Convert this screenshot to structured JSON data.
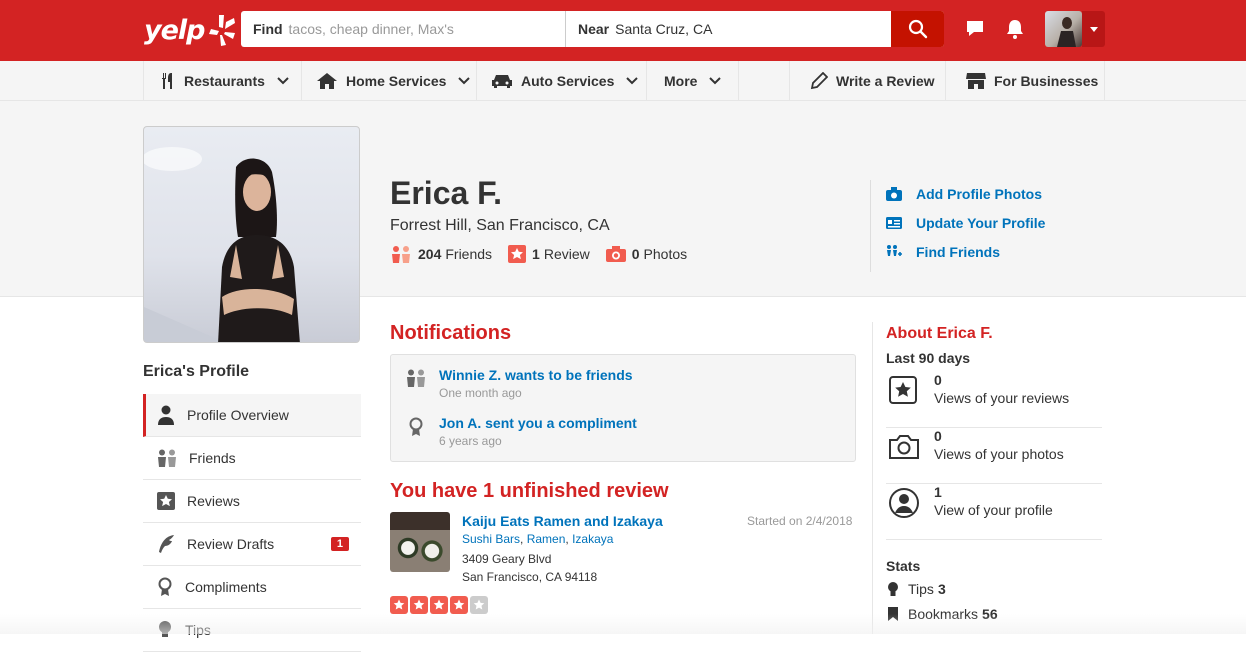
{
  "header": {
    "logo": "yelp",
    "search_find_label": "Find",
    "search_find_placeholder": "tacos, cheap dinner, Max's",
    "search_near_label": "Near",
    "search_near_value": "Santa Cruz, CA"
  },
  "nav": {
    "items": [
      {
        "label": "Restaurants"
      },
      {
        "label": "Home Services"
      },
      {
        "label": "Auto Services"
      },
      {
        "label": "More"
      }
    ],
    "write_review": "Write a Review",
    "for_businesses": "For Businesses"
  },
  "profile": {
    "name": "Erica F.",
    "location": "Forrest Hill, San Francisco, CA",
    "friends_count": "204",
    "friends_label": "Friends",
    "reviews_count": "1",
    "reviews_label": "Review",
    "photos_count": "0",
    "photos_label": "Photos"
  },
  "actions": {
    "add_photos": "Add Profile Photos",
    "update_profile": "Update Your Profile",
    "find_friends": "Find Friends"
  },
  "sidebar": {
    "title": "Erica's Profile",
    "items": [
      {
        "label": "Profile Overview"
      },
      {
        "label": "Friends"
      },
      {
        "label": "Reviews"
      },
      {
        "label": "Review Drafts",
        "badge": "1"
      },
      {
        "label": "Compliments"
      },
      {
        "label": "Tips"
      }
    ]
  },
  "notifications": {
    "title": "Notifications",
    "items": [
      {
        "text": "Winnie Z. wants to be friends",
        "time": "One month ago"
      },
      {
        "text": "Jon A. sent you a compliment",
        "time": "6 years ago"
      }
    ]
  },
  "unfinished": {
    "title": "You have 1 unfinished review",
    "business_name": "Kaiju Eats Ramen and Izakaya",
    "categories": [
      "Sushi Bars",
      "Ramen",
      "Izakaya"
    ],
    "address_line1": "3409 Geary Blvd",
    "address_line2": "San Francisco, CA 94118",
    "started": "Started on 2/4/2018",
    "rating": 4,
    "rating_max": 5
  },
  "about": {
    "title": "About Erica F.",
    "period": "Last 90 days",
    "stats": [
      {
        "value": "0",
        "label": "Views of your reviews"
      },
      {
        "value": "0",
        "label": "Views of your photos"
      },
      {
        "value": "1",
        "label": "View of your profile"
      }
    ],
    "stats_title": "Stats",
    "tips_label": "Tips",
    "tips_value": "3",
    "bookmarks_label": "Bookmarks",
    "bookmarks_value": "56"
  },
  "colors": {
    "brand_red": "#d32323",
    "link_blue": "#0073bb",
    "star_orange": "#f15c4f"
  }
}
